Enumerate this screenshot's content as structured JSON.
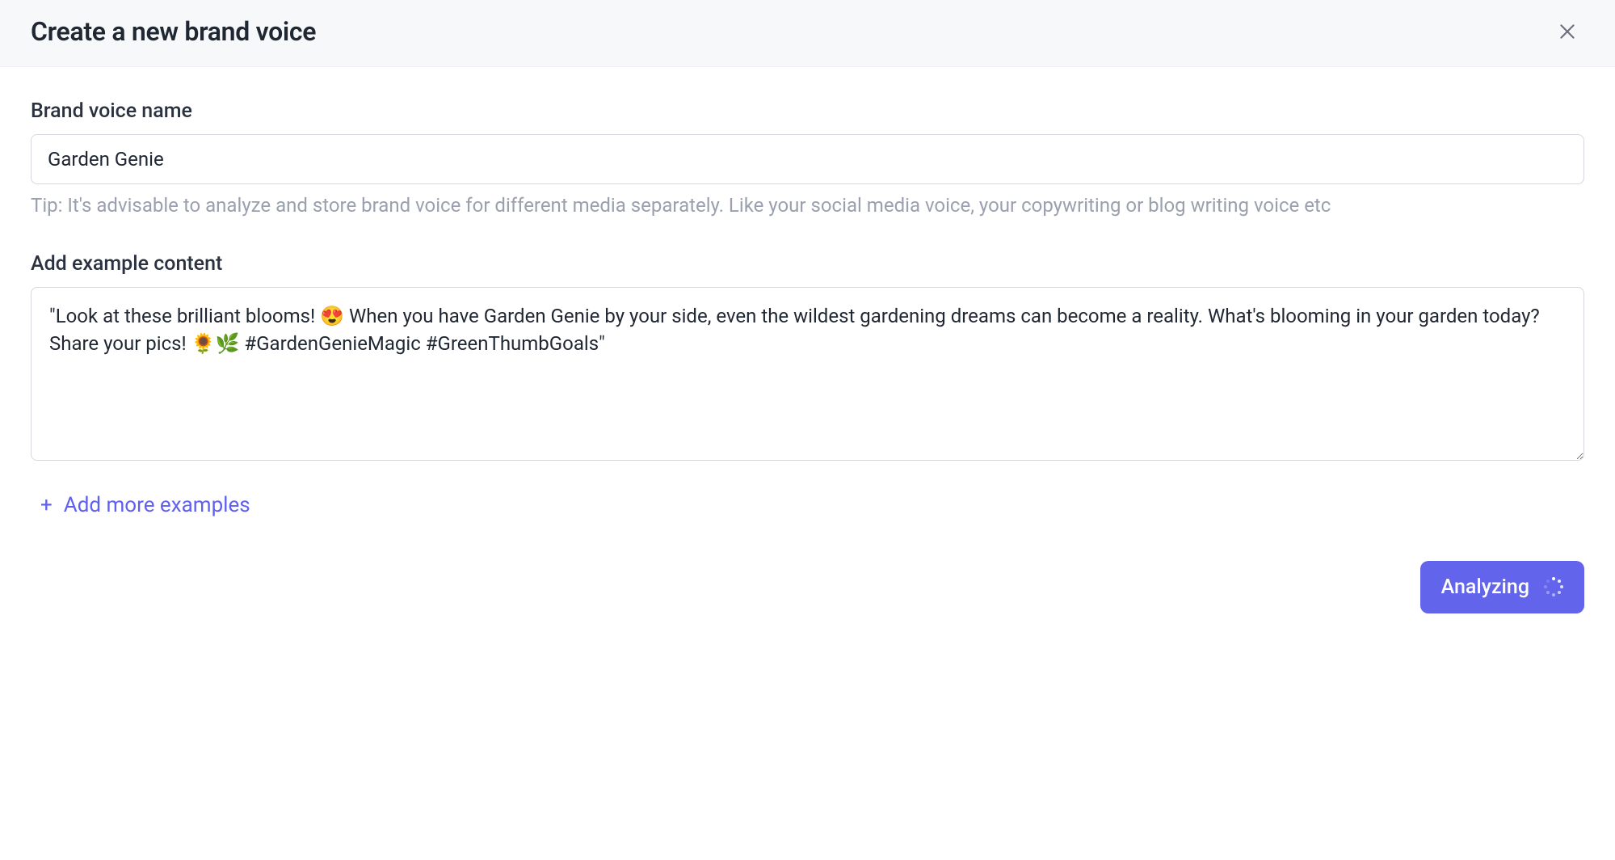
{
  "header": {
    "title": "Create a new brand voice"
  },
  "form": {
    "name_label": "Brand voice name",
    "name_value": "Garden Genie",
    "tip": "Tip: It's advisable to analyze and store brand voice for different media separately. Like your social media voice, your copywriting or blog writing voice etc",
    "example_label": "Add example content",
    "example_value": "\"Look at these brilliant blooms! 😍 When you have Garden Genie by your side, even the wildest gardening dreams can become a reality. What's blooming in your garden today? Share your pics! 🌻🌿 #GardenGenieMagic #GreenThumbGoals\"",
    "add_more_label": "Add more examples",
    "submit_label": "Analyzing"
  }
}
